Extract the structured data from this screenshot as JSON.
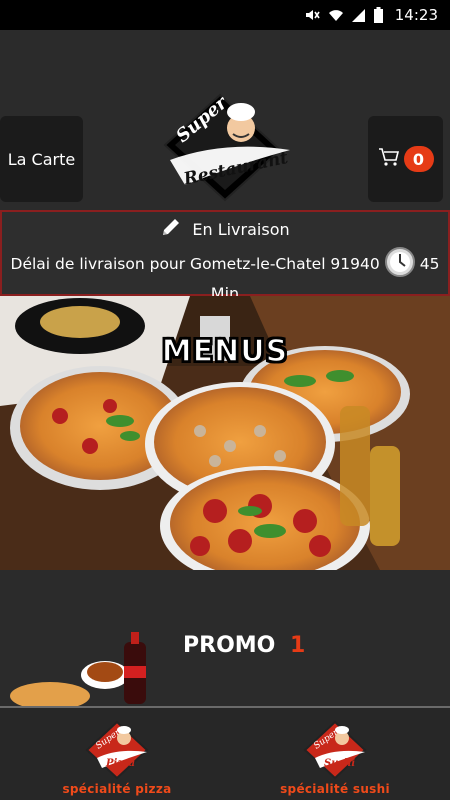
{
  "status_bar": {
    "time": "14:23",
    "icons": [
      "mute-icon",
      "wifi-icon",
      "signal-icon",
      "battery-icon"
    ]
  },
  "header": {
    "carte_label": "La Carte",
    "cart_count": "0",
    "logo_text_1": "Super",
    "logo_text_2": "Restaurant"
  },
  "delivery": {
    "mode_label": "En Livraison",
    "delay_text": "Délai de livraison pour Gometz-le-Chatel 91940",
    "delay_value": "45",
    "delay_unit": "Min"
  },
  "hero": {
    "title": "MENUS"
  },
  "promo": {
    "label": "PROMO",
    "number": "1"
  },
  "specialties": [
    {
      "label": "spécialité pizza",
      "badge_top": "Super",
      "badge_word": "Pizza"
    },
    {
      "label": "spécialité sushi",
      "badge_top": "Super",
      "badge_word": "Sushi"
    }
  ],
  "colors": {
    "accent": "#e63b16",
    "border_red": "#8a1f1f",
    "background": "#2b2b2b"
  }
}
